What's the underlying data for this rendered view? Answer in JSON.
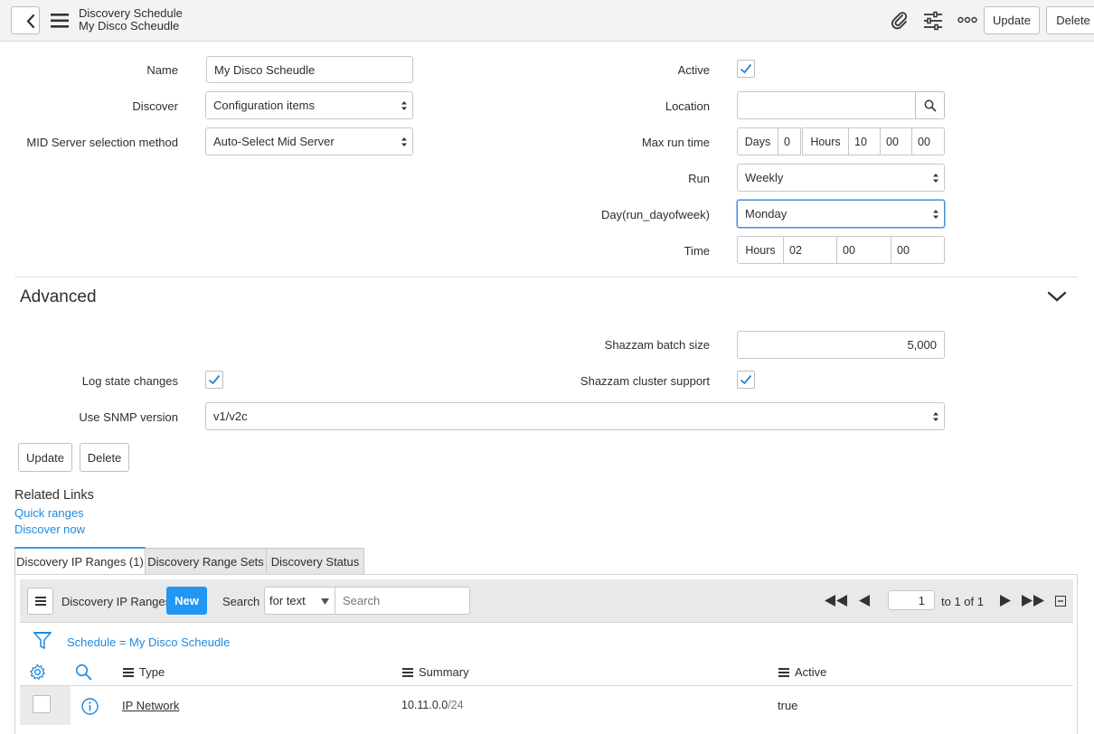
{
  "header": {
    "title": "Discovery Schedule",
    "subtitle": "My Disco Scheudle",
    "update_label": "Update",
    "delete_label": "Delete"
  },
  "form": {
    "name_label": "Name",
    "name_value": "My Disco Scheudle",
    "discover_label": "Discover",
    "discover_value": "Configuration items",
    "mid_label": "MID Server selection method",
    "mid_value": "Auto-Select Mid Server",
    "active_label": "Active",
    "active_checked": true,
    "location_label": "Location",
    "location_value": "",
    "maxrun_label": "Max run time",
    "maxrun": {
      "days_label": "Days",
      "days": "0",
      "hours_label": "Hours",
      "hours": "10",
      "minutes": "00",
      "seconds": "00"
    },
    "run_label": "Run",
    "run_value": "Weekly",
    "day_label": "Day(run_dayofweek)",
    "day_value": "Monday",
    "time_label": "Time",
    "time": {
      "hours_label": "Hours",
      "hours": "02",
      "minutes": "00",
      "seconds": "00"
    }
  },
  "advanced": {
    "title": "Advanced",
    "batch_label": "Shazzam batch size",
    "batch_value": "5,000",
    "log_label": "Log state changes",
    "log_checked": true,
    "cluster_label": "Shazzam cluster support",
    "cluster_checked": true,
    "snmp_label": "Use SNMP version",
    "snmp_value": "v1/v2c"
  },
  "actions": {
    "update_label": "Update",
    "delete_label": "Delete"
  },
  "related": {
    "title": "Related Links",
    "links": [
      "Quick ranges",
      "Discover now"
    ]
  },
  "tabs": [
    "Discovery IP Ranges (1)",
    "Discovery Range Sets",
    "Discovery Status"
  ],
  "list": {
    "title": "Discovery IP Ranges",
    "new_label": "New",
    "search_label": "Search",
    "search_field": "for text",
    "search_placeholder": "Search",
    "page_value": "1",
    "page_of": "to 1 of 1",
    "filter_text": "Schedule = My Disco Scheudle",
    "columns": [
      "Type",
      "Summary",
      "Active"
    ],
    "rows": [
      {
        "type": "IP Network",
        "summary_main": "10.11.0.0",
        "summary_mask": "/24",
        "active": "true"
      }
    ]
  },
  "colors": {
    "accent": "#2196f3",
    "link": "#1f8ae0",
    "check": "#2b7ed4"
  }
}
